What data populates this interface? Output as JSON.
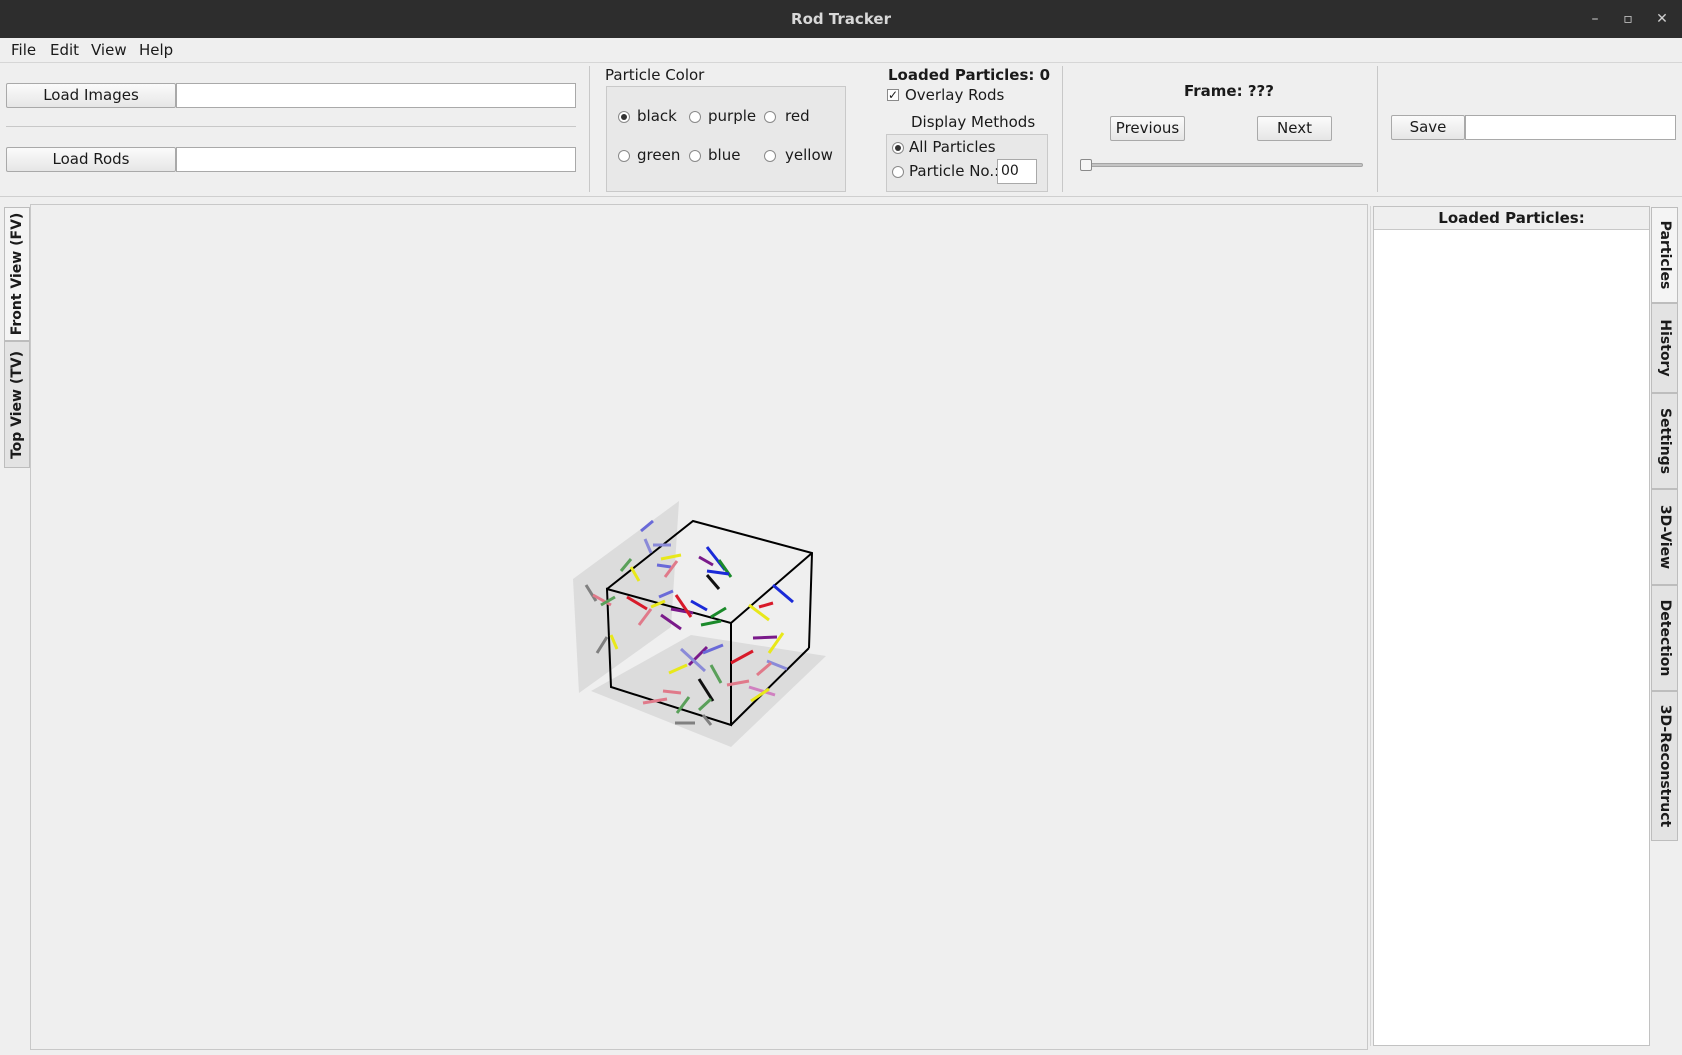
{
  "window": {
    "title": "Rod Tracker"
  },
  "menu": [
    "File",
    "Edit",
    "View",
    "Help"
  ],
  "toolbar": {
    "load_images_label": "Load Images",
    "load_images_path": "",
    "load_rods_label": "Load Rods",
    "load_rods_path": "",
    "particle_color": {
      "title": "Particle Color",
      "options": [
        "black",
        "purple",
        "red",
        "green",
        "blue",
        "yellow"
      ],
      "selected": "black"
    },
    "loaded_particles_label": "Loaded Particles: 0",
    "overlay_rods_label": "Overlay Rods",
    "overlay_rods_checked": true,
    "display_methods": {
      "title": "Display Methods",
      "all_particles_label": "All Particles",
      "particle_no_label": "Particle No.:",
      "particle_no_value": "00",
      "selected": "All Particles"
    },
    "frame_label": "Frame: ???",
    "previous_label": "Previous",
    "next_label": "Next",
    "frame_slider_value": 0,
    "save_label": "Save",
    "save_path": ""
  },
  "left_tabs": [
    "Front View (FV)",
    "Top View (TV)"
  ],
  "right_tabs": [
    "Particles",
    "History",
    "Settings",
    "3D-View",
    "Detection",
    "3D-Reconstruct"
  ],
  "particles_panel": {
    "header": "Loaded Particles:"
  },
  "icons": {
    "minimize": "minimize-icon",
    "restore": "restore-icon",
    "close": "close-icon"
  },
  "colors": {
    "titlebar": "#2d2d2d",
    "panel_bg": "#efefef",
    "rod_black": "#111111",
    "rod_purple": "#7a1a8a",
    "rod_red": "#d81a2a",
    "rod_green": "#1a8a2a",
    "rod_blue": "#1a2ad8",
    "rod_yellow": "#e8e81a"
  }
}
